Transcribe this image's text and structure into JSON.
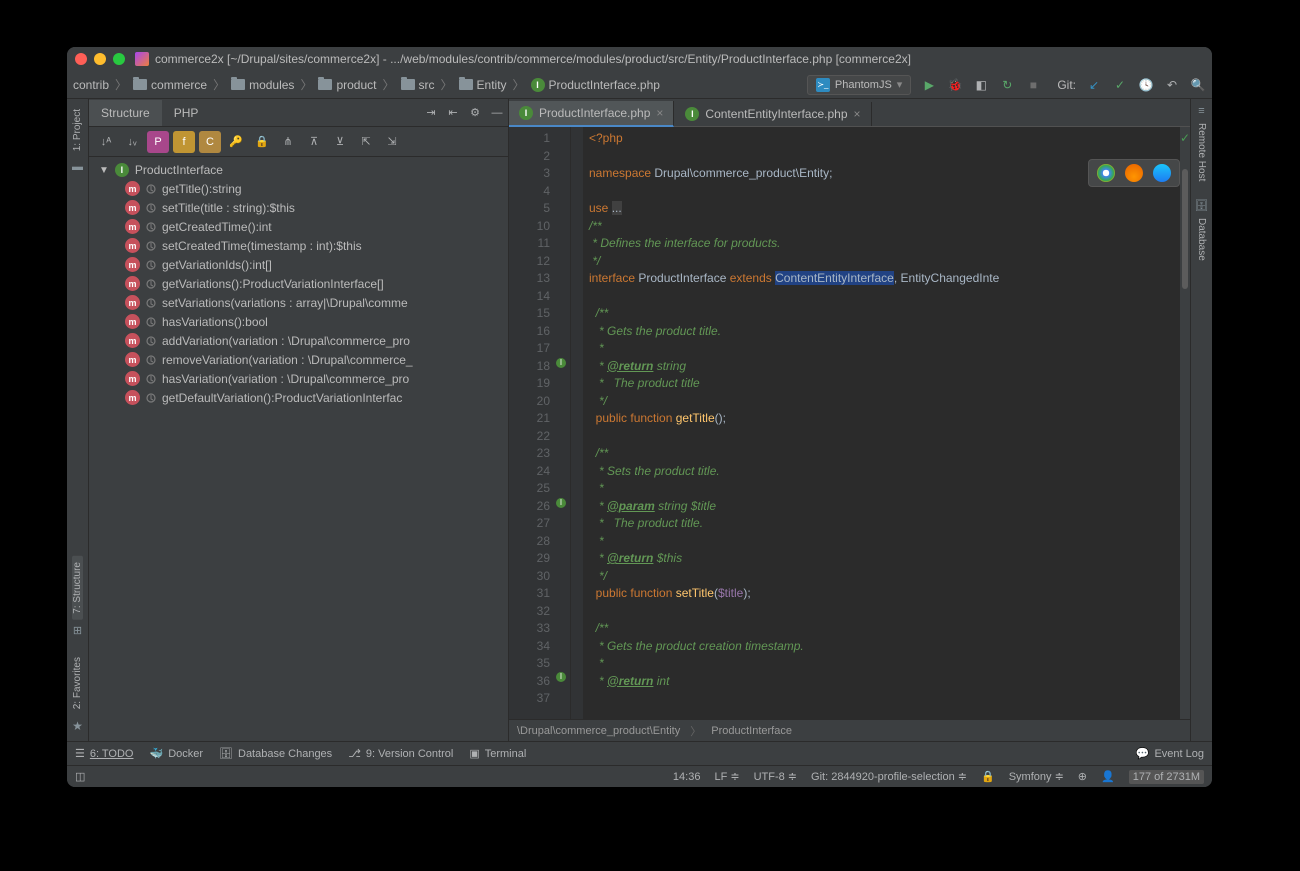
{
  "title": "commerce2x [~/Drupal/sites/commerce2x] - .../web/modules/contrib/commerce/modules/product/src/Entity/ProductInterface.php [commerce2x]",
  "breadcrumbs": [
    "contrib",
    "commerce",
    "modules",
    "product",
    "src",
    "Entity",
    "ProductInterface.php"
  ],
  "run_config": "PhantomJS",
  "git_label": "Git:",
  "left_rail": {
    "project": "1: Project",
    "structure": "7: Structure",
    "favorites": "2: Favorites"
  },
  "right_rail": {
    "remote": "Remote Host",
    "database": "Database"
  },
  "struct_tabs": {
    "structure": "Structure",
    "php": "PHP"
  },
  "interface_name": "ProductInterface",
  "methods": [
    "getTitle():string",
    "setTitle(title : string):$this",
    "getCreatedTime():int",
    "setCreatedTime(timestamp : int):$this",
    "getVariationIds():int[]",
    "getVariations():ProductVariationInterface[]",
    "setVariations(variations : array|\\Drupal\\comme",
    "hasVariations():bool",
    "addVariation(variation : \\Drupal\\commerce_pro",
    "removeVariation(variation : \\Drupal\\commerce_",
    "hasVariation(variation : \\Drupal\\commerce_pro",
    "getDefaultVariation():ProductVariationInterfac"
  ],
  "editor_tabs": [
    {
      "name": "ProductInterface.php",
      "active": true
    },
    {
      "name": "ContentEntityInterface.php",
      "active": false
    }
  ],
  "line_numbers": [
    1,
    2,
    3,
    4,
    5,
    10,
    11,
    12,
    13,
    14,
    15,
    16,
    17,
    18,
    19,
    20,
    21,
    22,
    23,
    24,
    25,
    26,
    27,
    28,
    29,
    30,
    31,
    32,
    33,
    34,
    35,
    36,
    37
  ],
  "code": {
    "l1": "<?php",
    "l3a": "namespace ",
    "l3b": "Drupal\\commerce_product\\Entity;",
    "l5a": "use ",
    "l5b": "...",
    "l11": "/**",
    "l12": " * Defines the interface for products.",
    "l13": " */",
    "l14a": "interface ",
    "l14b": "ProductInterface ",
    "l14c": "extends ",
    "l14d": "ContentEntityInterface",
    "l14e": ", EntityChangedInte",
    "l16": "  /**",
    "l17": "   * Gets the product title.",
    "l18": "   *",
    "l19a": "   * ",
    "l19b": "@return",
    "l19c": " string",
    "l20": "   *   The product title",
    "l21": "   */",
    "l22a": "  public ",
    "l22b": "function ",
    "l22c": "getTitle",
    "l22d": "();",
    "l24": "  /**",
    "l25": "   * Sets the product title.",
    "l26": "   *",
    "l27a": "   * ",
    "l27b": "@param",
    "l27c": " string $title",
    "l28": "   *   The product title.",
    "l29": "   *",
    "l30a": "   * ",
    "l30b": "@return",
    "l30c": " $this",
    "l31": "   */",
    "l32a": "  public ",
    "l32b": "function ",
    "l32c": "setTitle",
    "l32d": "(",
    "l32e": "$title",
    "l32f": ");",
    "l34": "  /**",
    "l35": "   * Gets the product creation timestamp.",
    "l36": "   *",
    "l37a": "   * ",
    "l37b": "@return",
    "l37c": " int"
  },
  "breadcrumb_path": {
    "ns": "\\Drupal\\commerce_product\\Entity",
    "cls": "ProductInterface"
  },
  "bottom": {
    "todo": "6: TODO",
    "docker": "Docker",
    "db": "Database Changes",
    "vcs": "9: Version Control",
    "term": "Terminal",
    "evt": "Event Log"
  },
  "status": {
    "pos": "14:36",
    "sep": "LF",
    "enc": "UTF-8",
    "branch": "Git: 2844920-profile-selection",
    "fw": "Symfony",
    "mem": "177 of 2731M"
  }
}
